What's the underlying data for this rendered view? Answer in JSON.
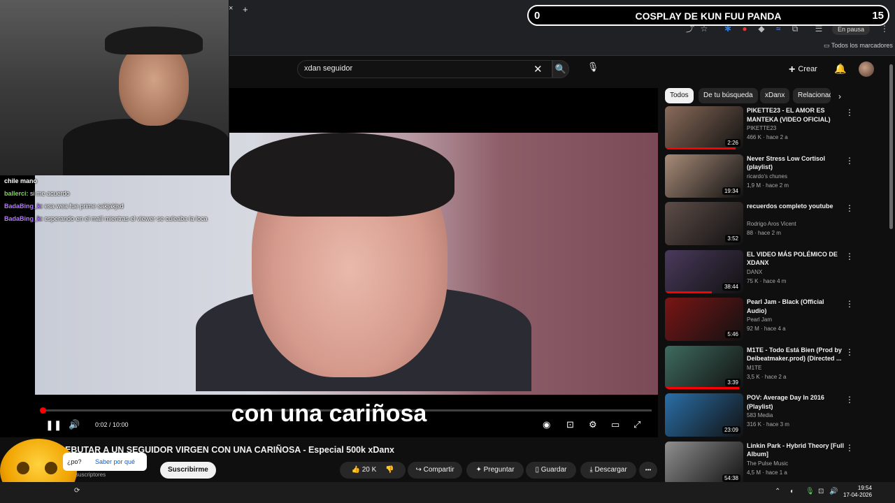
{
  "overlay": {
    "left_number": "0",
    "title": "COSPLAY DE KUN FUU PANDA",
    "right_number": "15"
  },
  "browser": {
    "new_tab": "+",
    "close_tab": "×",
    "paused_label": "En pausa",
    "bookmarks_label": "Todos los marcadores"
  },
  "search": {
    "value": "xdan seguidor",
    "clear_icon": "✕",
    "search_icon": "🔍",
    "mic_icon": "🎙"
  },
  "header": {
    "create_label": "Crear",
    "create_icon": "+",
    "bell_icon": "🔔"
  },
  "chat": [
    {
      "user": "chile mano",
      "text": "",
      "user_color": "#ffffff"
    },
    {
      "user": "ballerci:",
      "text": "si me acuerdo",
      "user_color": "#7ed957"
    },
    {
      "user": "BadaBing_k:",
      "text": "esa wea fue prime sakjakjsd",
      "user_color": "#b57aff"
    },
    {
      "user": "BadaBing_k:",
      "text": "esperando en el mall mientras el viewer se culeaba la loca",
      "user_color": "#b57aff"
    }
  ],
  "player": {
    "subtitle": "con una cariñosa",
    "time": "0:02 / 10:00",
    "progress_fraction": 0.003,
    "play_icon": "❚❚",
    "volume_icon": "🔊"
  },
  "video": {
    "title": "DEBUTAR A UN SEGUIDOR VIRGEN CON UNA CARIÑOSA - Especial 500k xDanx",
    "subscribers": "suscriptores",
    "subscribe_label": "Suscribirme",
    "popup_question": "¿po?",
    "popup_link": "Saber por qué",
    "likes": "20 K",
    "share_label": "Compartir",
    "ask_label": "Preguntar",
    "save_label": "Guardar",
    "download_label": "Descargar",
    "more_icon": "•••"
  },
  "chips": [
    "Todos",
    "De tu búsqueda",
    "xDanx",
    "Relacionados"
  ],
  "recommendations": [
    {
      "title": "PIKETTE23 - EL AMOR ES MANTEKA (VIDEO OFICIAL)",
      "channel": "PIKETTE23",
      "meta": "466 K · hace 2 a",
      "duration": "2:26",
      "thumb_color": "#8a6b5a",
      "watched": 0.9
    },
    {
      "title": "Never Stress Low Cortisol (playlist)",
      "channel": "ricardo's chunes",
      "meta": "1,9 M · hace 2 m",
      "duration": "19:34",
      "thumb_color": "#a88b78",
      "watched": 0.0
    },
    {
      "title": "recuerdos completo youtube",
      "channel": "Rodrigo Aros Vicent",
      "meta": "88 · hace 2 m",
      "duration": "3:52",
      "thumb_color": "#5e4d48",
      "watched": 0.0
    },
    {
      "title": "EL VIDEO MÁS POLÉMICO DE XDANX",
      "channel": "DANX",
      "meta": "75 K · hace 4 m",
      "duration": "38:44",
      "thumb_color": "#4a3a5c",
      "watched": 0.6
    },
    {
      "title": "Pearl Jam - Black (Official Audio)",
      "channel": "Pearl Jam",
      "meta": "92 M · hace 4 a",
      "duration": "5:46",
      "thumb_color": "#7a1515",
      "watched": 0.0
    },
    {
      "title": "M1TE - Todo Está Bien (Prod by Deibeatmaker.prod) (Directed ...",
      "channel": "M1TE",
      "meta": "3,5 K · hace 2 a",
      "duration": "3:39",
      "thumb_color": "#3f6b5e",
      "watched": 0.95
    },
    {
      "title": "POV: Average Day In 2016 (Playlist)",
      "channel": "583 Media",
      "meta": "316 K · hace 3 m",
      "duration": "23:09",
      "thumb_color": "#2a6fa8",
      "watched": 0.0
    },
    {
      "title": "Linkin Park - Hybrid Theory [Full Album]",
      "channel": "The Pulse Music",
      "meta": "4,5 M · hace 1 a",
      "duration": "54:38",
      "thumb_color": "#8f8f8f",
      "watched": 0.0
    }
  ],
  "taskbar": {
    "time": "19:54",
    "date": "17-04-2026"
  }
}
